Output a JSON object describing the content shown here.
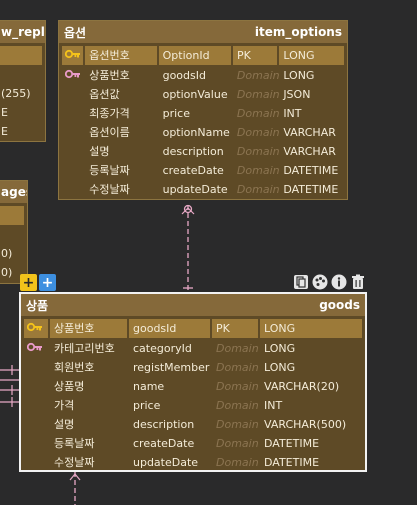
{
  "partial_left_top": {
    "header_text": "w_reply",
    "row_texts": [
      "(255)",
      "E",
      "E"
    ]
  },
  "partial_left_mid": {
    "header_text": "ages",
    "row_texts": [
      "0)",
      "0)"
    ]
  },
  "option_entity": {
    "title": "옵션",
    "name": "item_options",
    "rows": [
      {
        "key": "pk",
        "logical": "옵션번호",
        "physical": "OptionId",
        "domain": "PK",
        "type": "LONG"
      },
      {
        "key": "fk",
        "logical": "상품번호",
        "physical": "goodsId",
        "domain": "Domain",
        "type": "LONG"
      },
      {
        "key": "",
        "logical": "옵션값",
        "physical": "optionValue",
        "domain": "Domain",
        "type": "JSON"
      },
      {
        "key": "",
        "logical": "최종가격",
        "physical": "price",
        "domain": "Domain",
        "type": "INT"
      },
      {
        "key": "",
        "logical": "옵션이름",
        "physical": "optionName",
        "domain": "Domain",
        "type": "VARCHAR"
      },
      {
        "key": "",
        "logical": "설명",
        "physical": "description",
        "domain": "Domain",
        "type": "VARCHAR"
      },
      {
        "key": "",
        "logical": "등록날짜",
        "physical": "createDate",
        "domain": "Domain",
        "type": "DATETIME"
      },
      {
        "key": "",
        "logical": "수정날짜",
        "physical": "updateDate",
        "domain": "Domain",
        "type": "DATETIME"
      }
    ]
  },
  "goods_entity": {
    "title": "상품",
    "name": "goods",
    "rows": [
      {
        "key": "pk",
        "logical": "상품번호",
        "physical": "goodsId",
        "domain": "PK",
        "type": "LONG"
      },
      {
        "key": "fk",
        "logical": "카테고리번호",
        "physical": "categoryId",
        "domain": "Domain",
        "type": "LONG"
      },
      {
        "key": "",
        "logical": "회원번호",
        "physical": "registMember",
        "domain": "Domain",
        "type": "LONG"
      },
      {
        "key": "",
        "logical": "상품명",
        "physical": "name",
        "domain": "Domain",
        "type": "VARCHAR(20)"
      },
      {
        "key": "",
        "logical": "가격",
        "physical": "price",
        "domain": "Domain",
        "type": "INT"
      },
      {
        "key": "",
        "logical": "설명",
        "physical": "description",
        "domain": "Domain",
        "type": "VARCHAR(500)"
      },
      {
        "key": "",
        "logical": "등록날짜",
        "physical": "createDate",
        "domain": "Domain",
        "type": "DATETIME"
      },
      {
        "key": "",
        "logical": "수정날짜",
        "physical": "updateDate",
        "domain": "Domain",
        "type": "DATETIME"
      }
    ]
  },
  "toolbar": {
    "add_column_label": "+",
    "add_pk_label": "+",
    "icons": [
      "copy-icon",
      "palette-icon",
      "info-icon",
      "trash-icon"
    ]
  },
  "colors": {
    "background": "#2a2a2b",
    "entity_body": "#5e4a26",
    "entity_header": "#85693a",
    "pk_key": "#f5c31a",
    "fk_key": "#e89ac8",
    "relationship_line": "#e8a9c6"
  }
}
